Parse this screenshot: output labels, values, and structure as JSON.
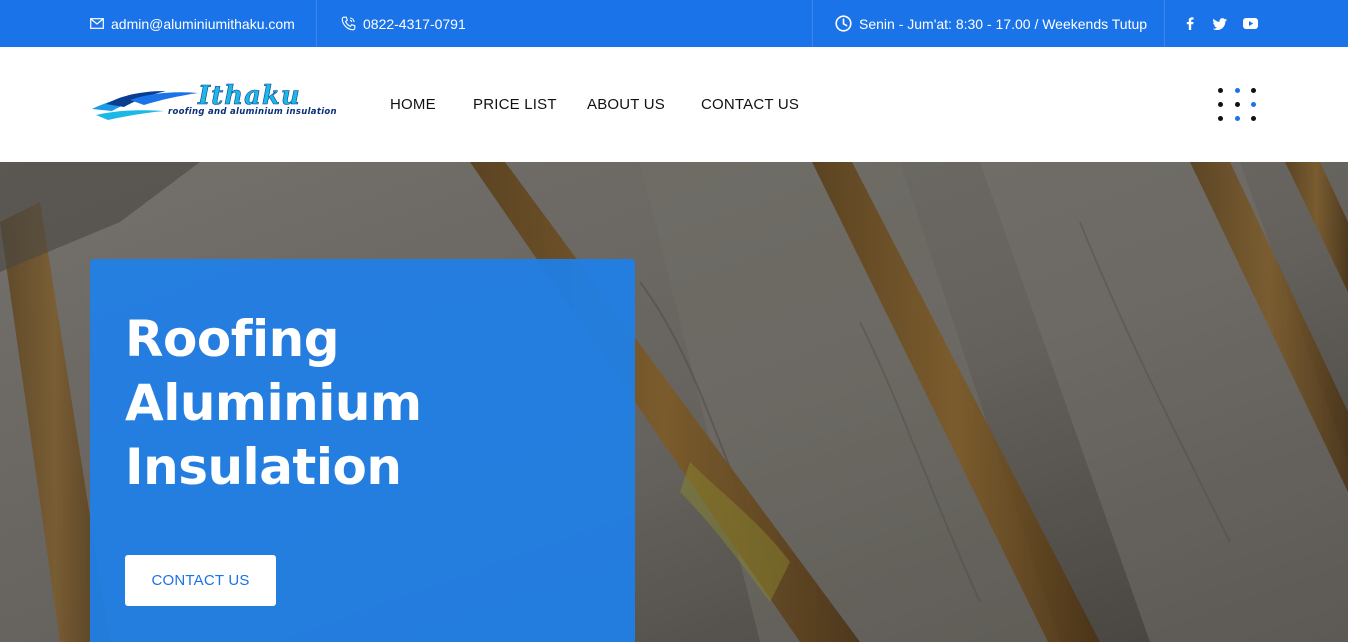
{
  "topbar": {
    "email": "admin@aluminiumithaku.com",
    "phone": "0822-4317-0791",
    "hours": "Senin - Jum'at: 8:30 - 17.00 / Weekends Tutup",
    "icons": [
      "envelope-icon",
      "phone-icon",
      "clock-icon",
      "facebook-icon",
      "twitter-icon",
      "youtube-icon"
    ],
    "background": "#1a73e8"
  },
  "header": {
    "logo": {
      "title": "Ithaku",
      "subtitle": "roofing and aluminium insulation",
      "colors": {
        "title": "#1cb8e8",
        "subtitle": "#0a2f7a"
      }
    },
    "nav": [
      "HOME",
      "PRICE LIST",
      "ABOUT US",
      "CONTACT US"
    ],
    "menu_icon": "dots-grid-icon",
    "dot_colors": [
      "#111111",
      "#1a73e8",
      "#111111",
      "#111111",
      "#111111",
      "#1a73e8",
      "#111111",
      "#1a73e8",
      "#111111"
    ]
  },
  "hero": {
    "title_lines": [
      "Roofing",
      "Aluminium",
      "Insulation"
    ],
    "button_label": "CONTACT US",
    "card_color": "#1f80e8"
  }
}
